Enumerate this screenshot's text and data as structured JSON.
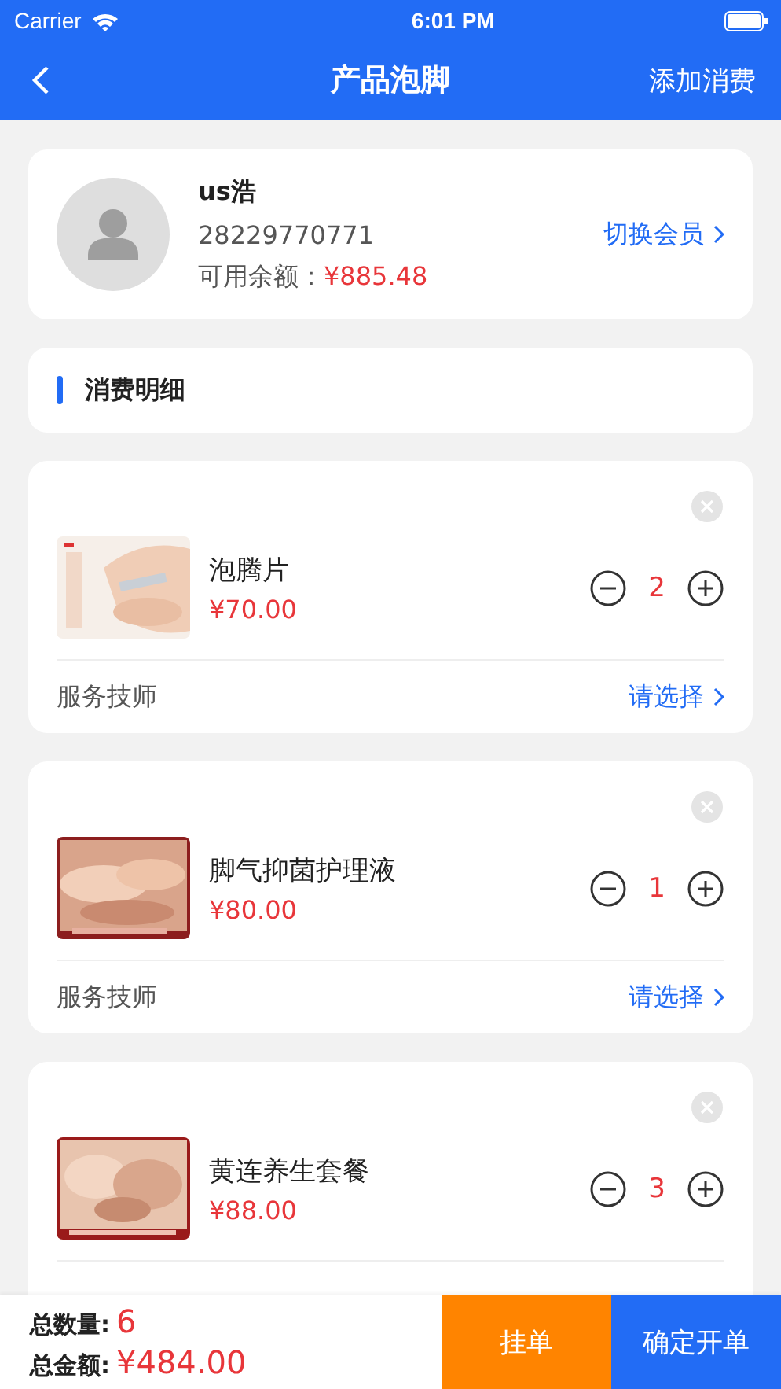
{
  "status_bar": {
    "carrier": "Carrier",
    "time": "6:01 PM"
  },
  "nav": {
    "title": "产品泡脚",
    "action": "添加消费"
  },
  "member": {
    "name": "us浩",
    "phone": "28229770771",
    "balance_label": "可用余额：",
    "balance": "¥885.48",
    "switch": "切换会员"
  },
  "section": {
    "title": "消费明细"
  },
  "items": [
    {
      "name": "泡腾片",
      "price": "¥70.00",
      "quantity": "2",
      "tech_label": "服务技师",
      "tech_value": "请选择"
    },
    {
      "name": "脚气抑菌护理液",
      "price": "¥80.00",
      "quantity": "1",
      "tech_label": "服务技师",
      "tech_value": "请选择"
    },
    {
      "name": "黄连养生套餐",
      "price": "¥88.00",
      "quantity": "3"
    }
  ],
  "footer": {
    "count_label": "总数量:",
    "count": "6",
    "total_label": "总金额:",
    "total": "¥484.00",
    "hold_button": "挂单",
    "confirm_button": "确定开单"
  }
}
